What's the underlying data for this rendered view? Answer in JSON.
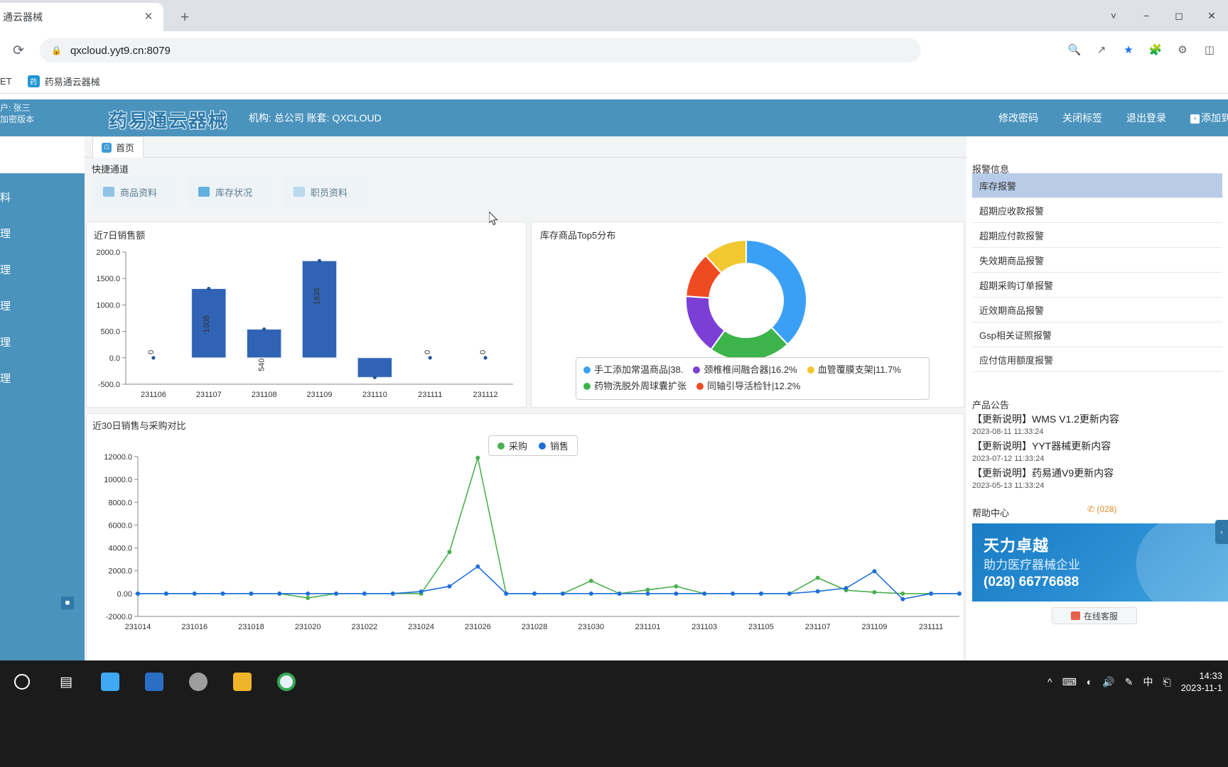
{
  "browser": {
    "tab_title": "通云器械",
    "tab_close_icon": "close-icon",
    "new_tab_icon": "plus-icon",
    "reload_icon": "reload-icon",
    "lock_icon": "lock-icon",
    "url": "qxcloud.yyt9.cn:8079",
    "toolbar_icons": [
      "zoom-search-icon",
      "share-icon",
      "star-icon",
      "puzzle-extension-icon",
      "sync-icon",
      "sidepanel-icon"
    ],
    "window_buttons": [
      "chevron-down-icon",
      "minimize-icon",
      "maximize-icon",
      "close-icon"
    ],
    "bookmarks_partial_left": "ET",
    "bookmark": {
      "label": "药易通云器械",
      "favicon_text": "药"
    }
  },
  "app_header": {
    "user_line1": "户: 张三",
    "user_line2": "加密版本",
    "brand": "药易通云器械",
    "org_info": "机构: 总公司 账套: QXCLOUD",
    "links": [
      "修改密码",
      "关闭标签",
      "退出登录"
    ],
    "quick_add_label": "添加到快捷通道",
    "quick_add_icon": "plus-square-icon"
  },
  "sidebar": {
    "items": [
      "料",
      "理",
      "理",
      "理",
      "理",
      "理"
    ],
    "collapse_icon": "collapse-icon"
  },
  "main": {
    "tab_home": "首页",
    "tab_home_icon": "home-icon",
    "quick_title": "快捷通道",
    "quick_cards": [
      {
        "label": "商品资料",
        "icon": "diamond-icon"
      },
      {
        "label": "库存状况",
        "icon": "box-icon"
      },
      {
        "label": "职员资料",
        "icon": "person-card-icon"
      }
    ]
  },
  "chart_data": [
    {
      "type": "bar",
      "title": "近7日销售额",
      "categories": [
        "231106",
        "231107",
        "231108",
        "231109",
        "231110",
        "231111",
        "231112"
      ],
      "values": [
        0,
        1308,
        540,
        1835,
        -370,
        0,
        0
      ],
      "point_labels": [
        "0",
        "1308",
        "540",
        "1835",
        "",
        "0",
        "0"
      ],
      "yticks": [
        "2000.0",
        "1500.0",
        "1000.0",
        "500.0",
        "0.0",
        "-500.0"
      ],
      "ylim": [
        -500,
        2000
      ],
      "xlabel": "",
      "ylabel": "",
      "grid": false,
      "series_color": "#3063b4",
      "point_color": "#27549c"
    },
    {
      "type": "pie",
      "title": "库存商品Top5分布",
      "labels": [
        "手工添加常温商品",
        "颈椎椎间融合器",
        "血管覆膜支架",
        "药物洗脱外周球囊扩张",
        "同轴引导活检针"
      ],
      "percents": [
        38.0,
        16.2,
        11.7,
        21.9,
        12.2
      ],
      "legend": [
        {
          "text": "手工添加常温商品|38.",
          "color": "#3aa0f5"
        },
        {
          "text": "颈椎椎间融合器|16.2%",
          "color": "#7c3fd6"
        },
        {
          "text": "血管覆膜支架|11.7%",
          "color": "#f2c831"
        },
        {
          "text": "药物洗脱外周球囊扩张",
          "color": "#3cb44a"
        },
        {
          "text": "同轴引导活检针|12.2%",
          "color": "#ef4b23"
        }
      ],
      "legend_position": "bottom"
    },
    {
      "type": "line",
      "title": "近30日销售与采购对比",
      "legend": [
        {
          "name": "采购",
          "color": "#4cb050"
        },
        {
          "name": "销售",
          "color": "#1e6fd9"
        }
      ],
      "categories": [
        "231014",
        "231015",
        "231016",
        "231017",
        "231018",
        "231019",
        "231020",
        "231021",
        "231022",
        "231023",
        "231024",
        "231025",
        "231026",
        "231027",
        "231028",
        "231029",
        "231030",
        "231031",
        "231101",
        "231102",
        "231103",
        "231104",
        "231105",
        "231106",
        "231107",
        "231108",
        "231109",
        "231110",
        "231111",
        "231112"
      ],
      "xticks": [
        "231014",
        "231016",
        "231018",
        "231020",
        "231022",
        "231024",
        "231026",
        "231028",
        "231030",
        "231101",
        "231103",
        "231105",
        "231107",
        "231109",
        "231111"
      ],
      "yticks": [
        "12000.0",
        "10000.0",
        "8000.0",
        "6000.0",
        "4000.0",
        "2000.0",
        "0.00",
        "-2000.0"
      ],
      "ylim": [
        -2000,
        12000
      ],
      "series": [
        {
          "name": "采购",
          "color": "#4cb050",
          "values": [
            0,
            0,
            0,
            0,
            0,
            0,
            -380,
            0,
            0,
            0,
            0,
            3650,
            11900,
            0,
            0,
            0,
            1120,
            0,
            330,
            640,
            0,
            0,
            0,
            0,
            1380,
            300,
            120,
            0,
            0,
            0
          ]
        },
        {
          "name": "销售",
          "color": "#1e6fd9",
          "values": [
            0,
            0,
            0,
            0,
            0,
            0,
            0,
            0,
            0,
            0,
            180,
            640,
            2370,
            0,
            0,
            0,
            0,
            0,
            0,
            0,
            0,
            0,
            0,
            0,
            200,
            480,
            1960,
            -480,
            0,
            0
          ]
        }
      ]
    }
  ],
  "right_panel": {
    "alarm_title": "报警信息",
    "alarm_items": [
      "库存报警",
      "超期应收款报警",
      "超期应付款报警",
      "失效期商品报警",
      "超期采购订单报警",
      "近效期商品报警",
      "Gsp相关证照报警",
      "应付信用额度报警"
    ],
    "notice_title": "产品公告",
    "notices": [
      {
        "title": "【更新说明】WMS V1.2更新内容",
        "date": "2023-08-11 11:33:24"
      },
      {
        "title": "【更新说明】YYT器械更新内容",
        "date": "2023-07-12 11:33:24"
      },
      {
        "title": "【更新说明】药易通V9更新内容",
        "date": "2023-05-13 11:33:24"
      }
    ],
    "help_title": "帮助中心",
    "help_phone": "(028)",
    "help_phone_icon": "phone-icon",
    "ad": {
      "line1": "天力卓越",
      "line2": "助力医疗器械企业",
      "line3": "(028) 66776688"
    },
    "chat_label": "在线客服",
    "chat_icon": "headset-icon",
    "side_float_icon": "chevron-icon"
  },
  "taskbar": {
    "apps": [
      "start-circle-icon",
      "task-view-icon",
      "explorer-blue-icon",
      "outlook-icon",
      "browser-circle-icon",
      "folder-icon",
      "chrome-icon"
    ],
    "tray": [
      "chevron-up-icon",
      "keyboard-icon",
      "network-icon",
      "volume-icon",
      "pen-icon",
      "ime-中",
      "ime-keyboard-icon"
    ],
    "clock_time": "14:33",
    "clock_date": "2023-11-1"
  }
}
